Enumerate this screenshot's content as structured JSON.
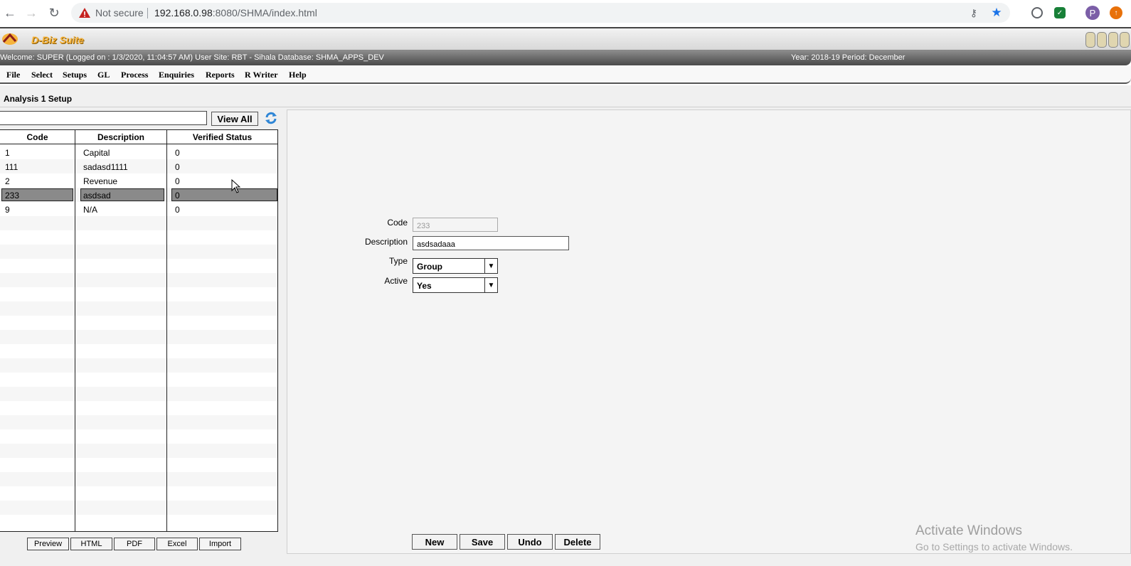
{
  "browser": {
    "not_secure": "Not secure",
    "url_host": "192.168.0.98",
    "url_rest": ":8080/SHMA/index.html",
    "profile_initial": "P"
  },
  "app": {
    "logo_text": "D-Biz Suite",
    "welcome": "Welcome: SUPER (Logged on : 1/3/2020, 11:04:57 AM) User Site: RBT - Sihala Database: SHMA_APPS_DEV",
    "year_period": "Year: 2018-19 Period: December"
  },
  "menu": [
    "File",
    "Select",
    "Setups",
    "GL",
    "Process",
    "Enquiries",
    "Reports",
    "R Writer",
    "Help"
  ],
  "page": {
    "title": "Analysis 1 Setup",
    "view_all": "View All",
    "search_value": ""
  },
  "grid": {
    "columns": [
      "Code",
      "Description",
      "Verified Status"
    ],
    "rows": [
      {
        "code": "1",
        "description": "Capital",
        "status": "0"
      },
      {
        "code": "111",
        "description": "sadasd1111",
        "status": "0"
      },
      {
        "code": "2",
        "description": "Revenue",
        "status": "0"
      },
      {
        "code": "233",
        "description": "asdsad",
        "status": "0",
        "selected": true
      },
      {
        "code": "9",
        "description": "N/A",
        "status": "0"
      }
    ]
  },
  "export_buttons": [
    "Preview",
    "HTML",
    "PDF",
    "Excel",
    "Import"
  ],
  "form": {
    "code_label": "Code",
    "code_value": "233",
    "description_label": "Description",
    "description_value": "asdsadaaa",
    "type_label": "Type",
    "type_value": "Group",
    "active_label": "Active",
    "active_value": "Yes"
  },
  "actions": [
    "New",
    "Save",
    "Undo",
    "Delete"
  ],
  "watermark": {
    "line1": "Activate Windows",
    "line2": "Go to Settings to activate Windows."
  },
  "colors": {
    "selected_row": "#8a8a8a",
    "logo_orange": "#f6b33b"
  }
}
